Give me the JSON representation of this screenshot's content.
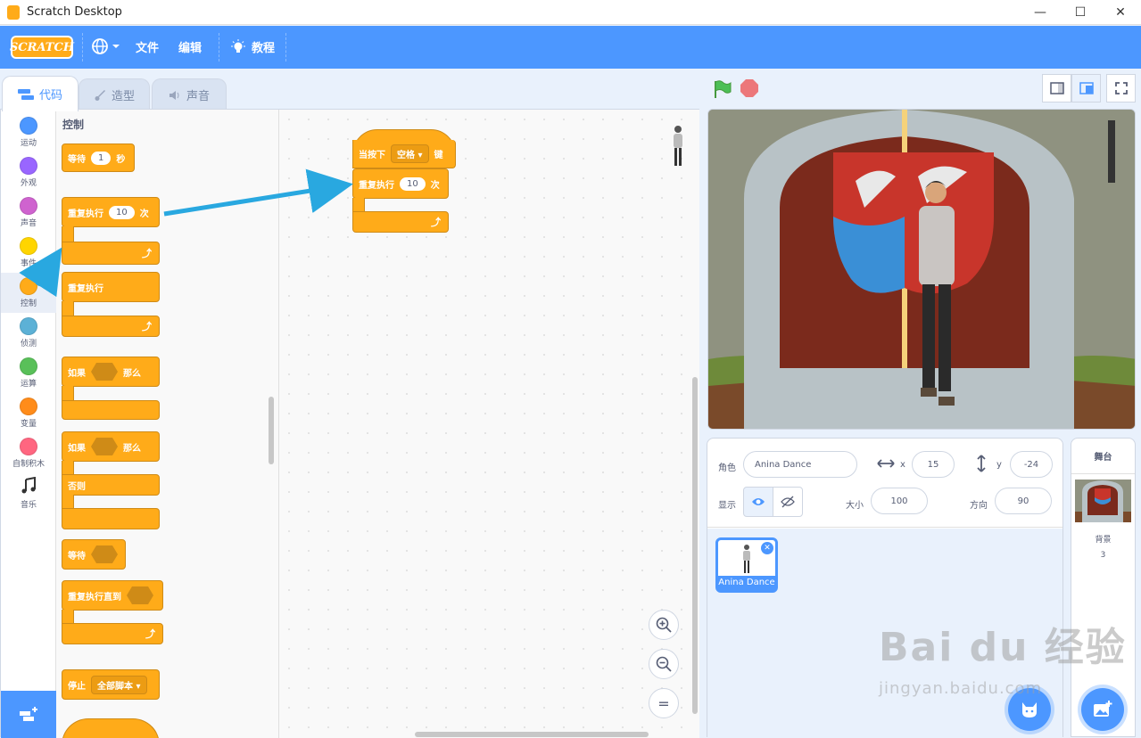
{
  "window": {
    "title": "Scratch Desktop",
    "minimize": "—",
    "maximize": "☐",
    "close": "✕"
  },
  "menubar": {
    "logo": "SCRATCH",
    "language_icon": "globe-icon",
    "file": "文件",
    "edit": "编辑",
    "tutorials": "教程"
  },
  "tabs": [
    {
      "label": "代码"
    },
    {
      "label": "造型"
    },
    {
      "label": "声音"
    }
  ],
  "categories": [
    {
      "label": "运动",
      "color": "#4c97ff"
    },
    {
      "label": "外观",
      "color": "#9966ff"
    },
    {
      "label": "声音",
      "color": "#cf63cf"
    },
    {
      "label": "事件",
      "color": "#ffd500"
    },
    {
      "label": "控制",
      "color": "#ffab19"
    },
    {
      "label": "侦测",
      "color": "#5cb1d6"
    },
    {
      "label": "运算",
      "color": "#59c059"
    },
    {
      "label": "变量",
      "color": "#ff8c1a"
    },
    {
      "label": "自制积木",
      "color": "#ff6680"
    },
    {
      "label": "音乐",
      "color": ""
    }
  ],
  "palette": {
    "title": "控制",
    "wait": {
      "label": "等待",
      "value": "1",
      "unit": "秒"
    },
    "repeat": {
      "label": "重复执行",
      "value": "10",
      "unit": "次"
    },
    "forever": {
      "label": "重复执行"
    },
    "if_then": {
      "if": "如果",
      "then": "那么"
    },
    "if_else": {
      "if": "如果",
      "then": "那么",
      "else": "否则"
    },
    "wait_until": {
      "label": "等待"
    },
    "repeat_until": {
      "label": "重复执行直到"
    },
    "stop": {
      "label": "停止",
      "option": "全部脚本"
    }
  },
  "script": {
    "hat": {
      "label": "当按下",
      "key": "空格",
      "suffix": "键"
    },
    "repeat": {
      "label": "重复执行",
      "value": "10",
      "unit": "次"
    }
  },
  "zoom": {
    "in": "+",
    "out": "−",
    "reset": "="
  },
  "sprite_info": {
    "sprite_label": "角色",
    "sprite_name": "Anina Dance",
    "x_label": "x",
    "x": "15",
    "y_label": "y",
    "y": "-24",
    "show_label": "显示",
    "size_label": "大小",
    "size": "100",
    "direction_label": "方向",
    "direction": "90"
  },
  "sprites": [
    {
      "name": "Anina Dance"
    }
  ],
  "stage_pane": {
    "title": "舞台",
    "backdrops_label": "背景",
    "backdrops_count": "3"
  },
  "watermark": {
    "brand": "Bai du 经验",
    "url": "jingyan.baidu.com"
  },
  "colors": {
    "menubar": "#4c97ff",
    "control": "#ffab19",
    "arrow": "#29a8e0"
  }
}
